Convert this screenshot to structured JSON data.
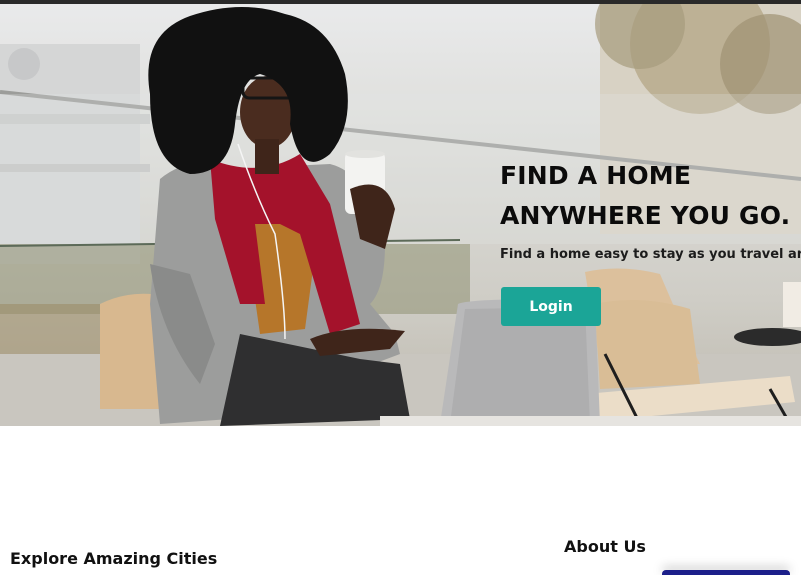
{
  "hero": {
    "title_line1": "FIND A HOME",
    "title_line2": "ANYWHERE YOU GO.",
    "subtitle": "Find a home easy to stay as you travel aro",
    "login_label": "Login"
  },
  "sections": {
    "explore_title": "Explore Amazing Cities",
    "about_title": "About Us"
  },
  "colors": {
    "accent": "#1ba597",
    "footer_accent": "#1c1f8a"
  }
}
